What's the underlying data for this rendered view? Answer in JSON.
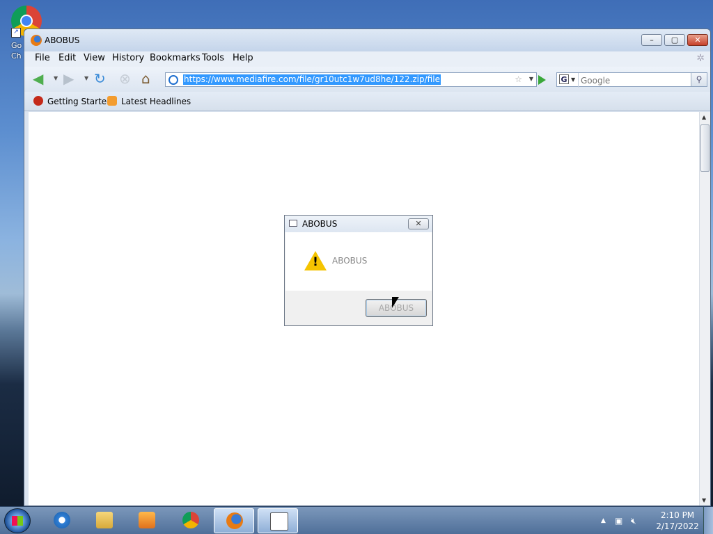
{
  "desktop": {
    "shortcut_label_line1": "Go",
    "shortcut_label_line2": "Ch"
  },
  "window": {
    "title": "ABOBUS",
    "buttons": {
      "minimize": "–",
      "maximize": "▢",
      "close": "✕"
    }
  },
  "menubar": {
    "items": [
      "File",
      "Edit",
      "View",
      "History",
      "Bookmarks",
      "Tools",
      "Help"
    ]
  },
  "navbar": {
    "url": "https://www.mediafire.com/file/gr10utc1w7ud8he/122.zip/file",
    "search_placeholder": "Google",
    "search_engine_letter": "G"
  },
  "bookmarks": {
    "items": [
      "Getting Started",
      "Latest Headlines"
    ]
  },
  "dialog": {
    "title": "ABOBUS",
    "message": "ABOBUS",
    "button_label": "ABOBUS",
    "close_glyph": "✕"
  },
  "taskbar": {
    "clock_time": "2:10 PM",
    "clock_date": "2/17/2022"
  },
  "icons": {
    "back": "back-arrow-icon",
    "forward": "forward-arrow-icon",
    "reload": "reload-icon",
    "stop": "stop-icon",
    "home": "home-icon",
    "warning": "warning-icon"
  },
  "colors": {
    "url_highlight": "#3399ff",
    "warning": "#f5c400",
    "go_arrow": "#3aa83a"
  }
}
